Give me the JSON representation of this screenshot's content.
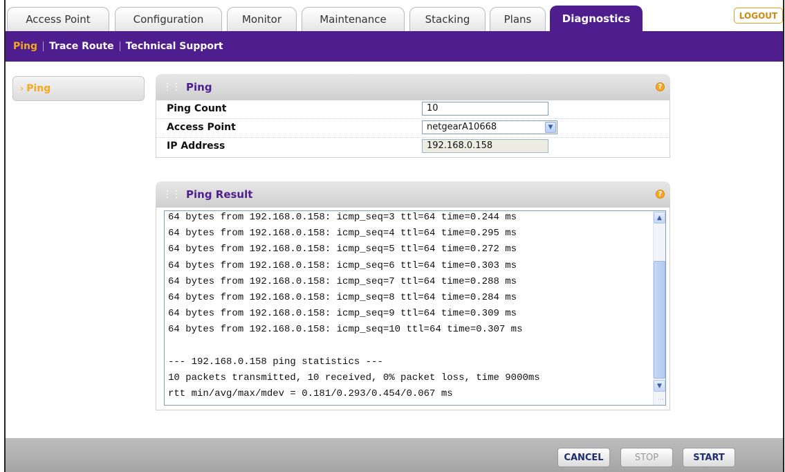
{
  "tabs": [
    {
      "label": "Access Point",
      "active": false
    },
    {
      "label": "Configuration",
      "active": false
    },
    {
      "label": "Monitor",
      "active": false
    },
    {
      "label": "Maintenance",
      "active": false
    },
    {
      "label": "Stacking",
      "active": false
    },
    {
      "label": "Plans",
      "active": false
    },
    {
      "label": "Diagnostics",
      "active": true
    }
  ],
  "logout_label": "LOGOUT",
  "submenu": [
    {
      "label": "Ping",
      "active": true
    },
    {
      "label": "Trace Route",
      "active": false
    },
    {
      "label": "Technical Support",
      "active": false
    }
  ],
  "leftnav": {
    "label": "Ping"
  },
  "ping_panel": {
    "title": "Ping",
    "ping_count": {
      "label": "Ping Count",
      "value": "10"
    },
    "access_point": {
      "label": "Access Point",
      "value": "netgearA10668"
    },
    "ip_address": {
      "label": "IP Address",
      "value": "192.168.0.158"
    }
  },
  "result_panel": {
    "title": "Ping Result",
    "lines": [
      "64 bytes from 192.168.0.158: icmp_seq=3 ttl=64 time=0.244 ms",
      "64 bytes from 192.168.0.158: icmp_seq=4 ttl=64 time=0.295 ms",
      "64 bytes from 192.168.0.158: icmp_seq=5 ttl=64 time=0.272 ms",
      "64 bytes from 192.168.0.158: icmp_seq=6 ttl=64 time=0.303 ms",
      "64 bytes from 192.168.0.158: icmp_seq=7 ttl=64 time=0.288 ms",
      "64 bytes from 192.168.0.158: icmp_seq=8 ttl=64 time=0.284 ms",
      "64 bytes from 192.168.0.158: icmp_seq=9 ttl=64 time=0.309 ms",
      "64 bytes from 192.168.0.158: icmp_seq=10 ttl=64 time=0.307 ms",
      "",
      "--- 192.168.0.158 ping statistics ---",
      "10 packets transmitted, 10 received, 0% packet loss, time 9000ms",
      "rtt min/avg/max/mdev = 0.181/0.293/0.454/0.067 ms"
    ]
  },
  "buttons": {
    "cancel": "CANCEL",
    "stop": "STOP",
    "start": "START"
  },
  "colors": {
    "brand_purple": "#4e1e8e",
    "accent_orange": "#f4a81d"
  }
}
